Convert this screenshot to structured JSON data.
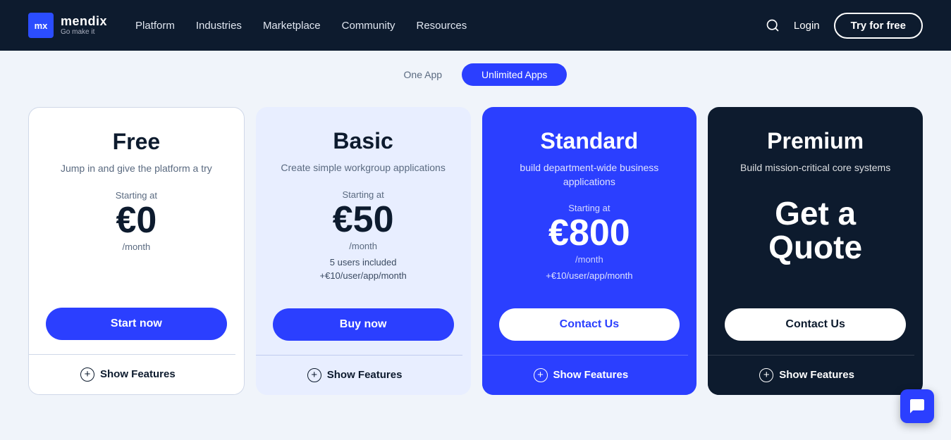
{
  "navbar": {
    "logo": {
      "abbreviation": "mx",
      "name": "mendix",
      "tagline": "Go make it"
    },
    "nav_links": [
      {
        "label": "Platform",
        "id": "platform"
      },
      {
        "label": "Industries",
        "id": "industries"
      },
      {
        "label": "Marketplace",
        "id": "marketplace"
      },
      {
        "label": "Community",
        "id": "community"
      },
      {
        "label": "Resources",
        "id": "resources"
      }
    ],
    "login_label": "Login",
    "try_free_label": "Try for free"
  },
  "top_tabs": [
    {
      "label": "One App",
      "active": false
    },
    {
      "label": "Unlimited Apps",
      "active": true
    }
  ],
  "pricing": {
    "cards": [
      {
        "id": "free",
        "title": "Free",
        "subtitle": "Jump in and give the platform a try",
        "starting_at": "Starting at",
        "price": "€0",
        "per_month": "/month",
        "price_note": "",
        "cta_label": "Start now",
        "show_features_label": "Show Features"
      },
      {
        "id": "basic",
        "title": "Basic",
        "subtitle": "Create simple workgroup applications",
        "starting_at": "Starting at",
        "price": "€50",
        "per_month": "/month",
        "price_note": "5 users included\n+€10/user/app/month",
        "cta_label": "Buy now",
        "show_features_label": "Show Features"
      },
      {
        "id": "standard",
        "title": "Standard",
        "subtitle": "build department-wide business applications",
        "starting_at": "Starting at",
        "price": "€800",
        "per_month": "/month",
        "price_note": "+€10/user/app/month",
        "cta_label": "Contact Us",
        "show_features_label": "Show Features"
      },
      {
        "id": "premium",
        "title": "Premium",
        "subtitle": "Build mission-critical core systems",
        "starting_at": "",
        "price": "",
        "per_month": "",
        "price_note": "",
        "get_quote": "Get a\nQuote",
        "cta_label": "Contact Us",
        "show_features_label": "Show Features"
      }
    ]
  },
  "chat_icon": "💬",
  "plus_symbol": "+"
}
